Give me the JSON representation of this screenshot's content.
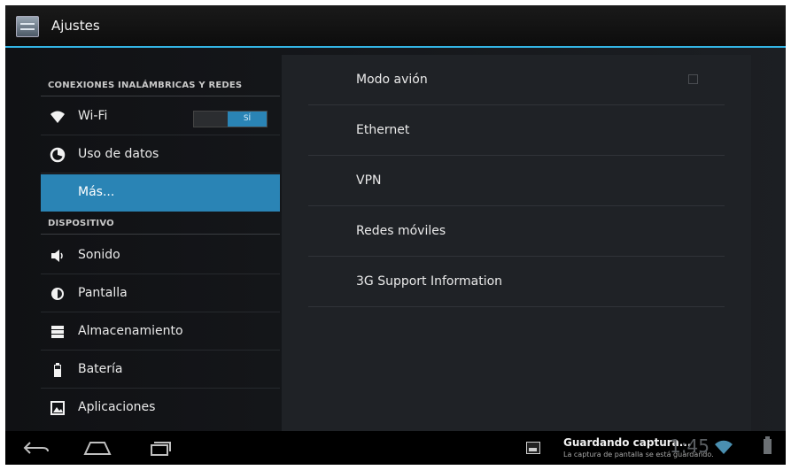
{
  "actionbar": {
    "title": "Ajustes"
  },
  "sidebar": {
    "sections": [
      {
        "header": "CONEXIONES INALÁMBRICAS Y REDES",
        "items": [
          {
            "label": "Wi-Fi",
            "icon": "wifi-icon",
            "toggle": "SÍ"
          },
          {
            "label": "Uso de datos",
            "icon": "data-usage-icon"
          },
          {
            "label": "Más...",
            "icon": "",
            "selected": true
          }
        ]
      },
      {
        "header": "DISPOSITIVO",
        "items": [
          {
            "label": "Sonido",
            "icon": "speaker-icon"
          },
          {
            "label": "Pantalla",
            "icon": "brightness-icon"
          },
          {
            "label": "Almacenamiento",
            "icon": "storage-icon"
          },
          {
            "label": "Batería",
            "icon": "battery-icon"
          },
          {
            "label": "Aplicaciones",
            "icon": "apps-icon"
          }
        ]
      }
    ]
  },
  "detail": {
    "items": [
      {
        "label": "Modo avión",
        "checkbox": true,
        "checked": false
      },
      {
        "label": "Ethernet"
      },
      {
        "label": "VPN"
      },
      {
        "label": "Redes móviles"
      },
      {
        "label": "3G Support Information"
      }
    ]
  },
  "statusbar": {
    "notification_title": "Guardando captura...",
    "notification_text": "La captura de pantalla se está guardando.",
    "clock": "1:45"
  },
  "colors": {
    "accent": "#33b5e5",
    "selected": "#2a84b5",
    "panel": "#1f2226"
  }
}
